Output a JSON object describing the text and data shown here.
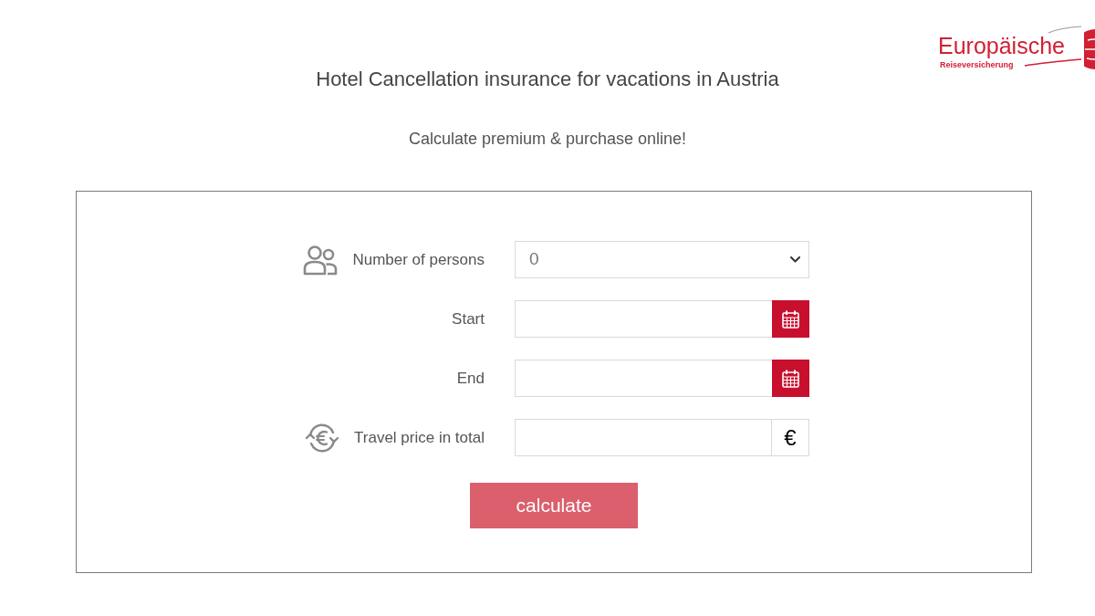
{
  "logo": {
    "name": "Europäische",
    "tagline": "Reiseversicherung"
  },
  "header": {
    "title": "Hotel Cancellation insurance for vacations in Austria",
    "subtitle": "Calculate premium & purchase online!"
  },
  "form": {
    "fields": [
      {
        "kind": "select",
        "label": "Number of persons",
        "value": "0"
      },
      {
        "kind": "date",
        "label": "Start"
      },
      {
        "kind": "date",
        "label": "End"
      },
      {
        "kind": "currency",
        "label": "Travel price in total",
        "addon": "€"
      }
    ],
    "button": {
      "label": "calculate",
      "disabled": true
    }
  }
}
